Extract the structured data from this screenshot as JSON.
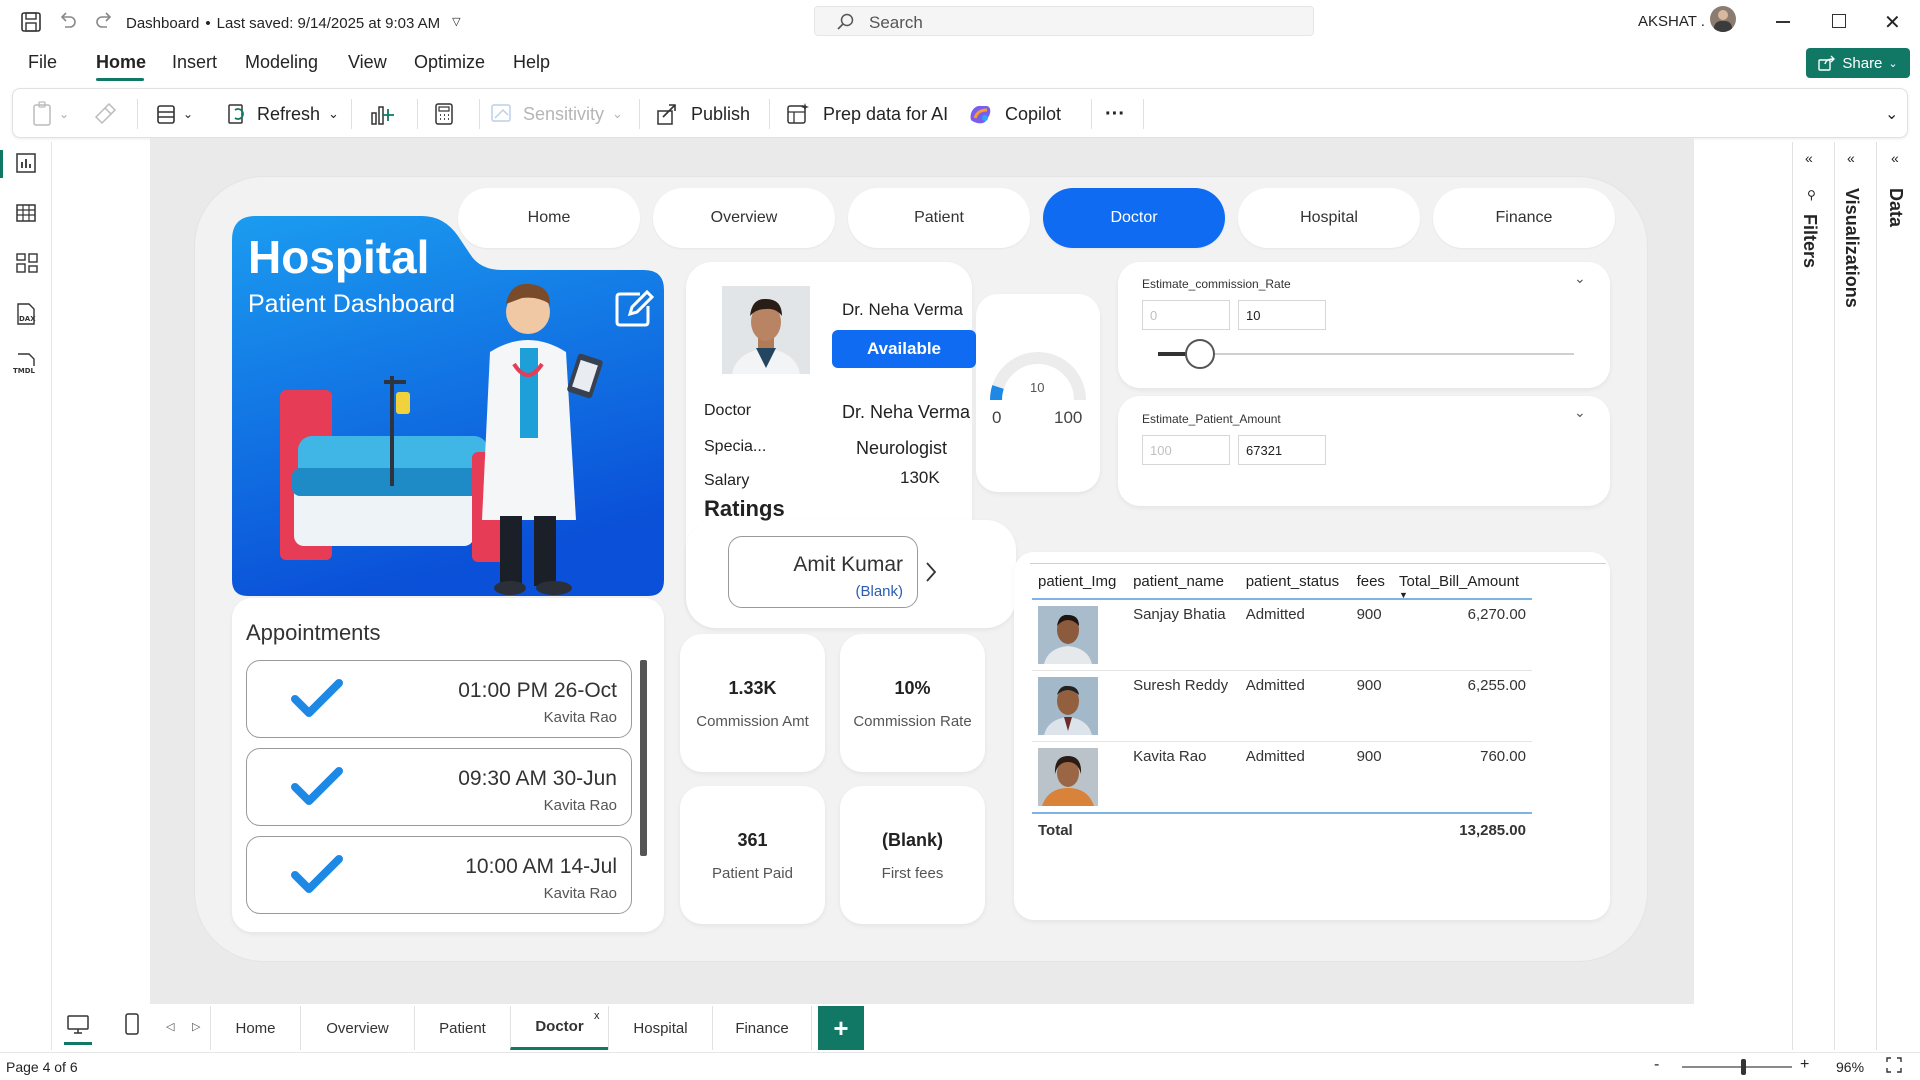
{
  "titlebar": {
    "doc_title": "Dashboard",
    "saved_text": "Last saved: 9/14/2025 at 9:03 AM",
    "search_placeholder": "Search",
    "user": "AKSHAT ."
  },
  "menu": [
    "File",
    "Home",
    "Insert",
    "Modeling",
    "View",
    "Optimize",
    "Help"
  ],
  "share_label": "Share",
  "toolbar": {
    "refresh": "Refresh",
    "sensitivity": "Sensitivity",
    "publish": "Publish",
    "prep_ai": "Prep data for AI",
    "copilot": "Copilot",
    "more": "···"
  },
  "report": {
    "nav": [
      "Home",
      "Overview",
      "Patient",
      "Doctor",
      "Hospital",
      "Finance"
    ],
    "active_nav": "Doctor",
    "hero_title": "Hospital",
    "hero_subtitle": "Patient Dashboard",
    "doctor": {
      "name": "Dr. Neha Verma",
      "status": "Available",
      "label_doctor": "Doctor",
      "doctor_value": "Dr. Neha Verma",
      "label_spec": "Specia...",
      "spec_value": "Neurologist",
      "label_salary": "Salary",
      "salary_value": "130K",
      "ratings_label": "Ratings"
    },
    "gauge": {
      "value": 10,
      "min": 0,
      "max": 100,
      "value_label": "10",
      "min_label": "0",
      "max_label": "100"
    },
    "rating_card": {
      "name": "Amit Kumar",
      "note": "(Blank)"
    },
    "slicers": [
      {
        "title": "Estimate_commission_Rate",
        "min": "0",
        "value": "10",
        "fraction": 0.1
      },
      {
        "title": "Estimate_Patient_Amount",
        "min": "100",
        "value": "67321"
      }
    ],
    "appointments_title": "Appointments",
    "appointments": [
      {
        "time": "01:00 PM 26-Oct",
        "who": "Kavita Rao"
      },
      {
        "time": "09:30 AM 30-Jun",
        "who": "Kavita Rao"
      },
      {
        "time": "10:00 AM 14-Jul",
        "who": "Kavita Rao"
      }
    ],
    "kpis": [
      {
        "value": "1.33K",
        "label": "Commission Amt"
      },
      {
        "value": "10%",
        "label": "Commission Rate"
      },
      {
        "value": "361",
        "label": "Patient Paid"
      },
      {
        "value": "(Blank)",
        "label": "First fees"
      }
    ],
    "table": {
      "headers": [
        "patient_Img",
        "patient_name",
        "patient_status",
        "fees",
        "Total_Bill_Amount"
      ],
      "rows": [
        {
          "name": "Sanjay Bhatia",
          "status": "Admitted",
          "fees": "900",
          "total": "6,270.00"
        },
        {
          "name": "Suresh Reddy",
          "status": "Admitted",
          "fees": "900",
          "total": "6,255.00"
        },
        {
          "name": "Kavita Rao",
          "status": "Admitted",
          "fees": "900",
          "total": "760.00"
        }
      ],
      "total_label": "Total",
      "total_value": "13,285.00"
    }
  },
  "right_panes": [
    "Filters",
    "Visualizations",
    "Data"
  ],
  "page_tabs": [
    "Home",
    "Overview",
    "Patient",
    "Doctor",
    "Hospital",
    "Finance"
  ],
  "active_page_tab": "Doctor",
  "status": {
    "page": "Page 4 of 6",
    "zoom": "96%",
    "zoom_fraction": 0.55
  },
  "colors": {
    "accent": "#0f6cf2",
    "brand_green": "#117865",
    "check_blue": "#1e88e5"
  }
}
